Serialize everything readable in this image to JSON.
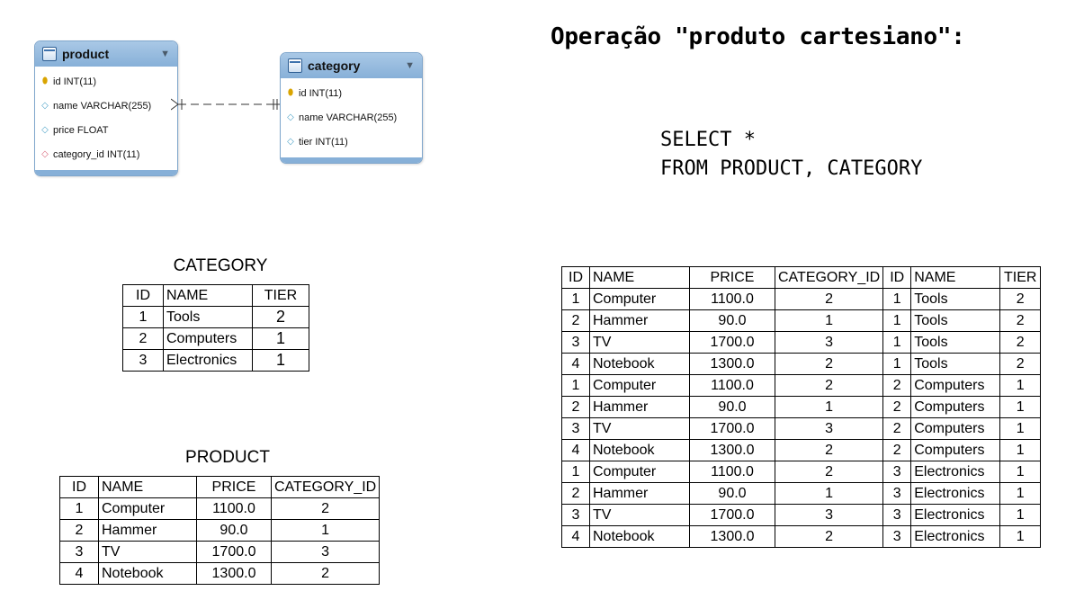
{
  "er_diagram": {
    "product": {
      "title": "product",
      "fields": [
        {
          "text": "id INT(11)",
          "icon": "key-icon"
        },
        {
          "text": "name VARCHAR(255)",
          "icon": "column-icon"
        },
        {
          "text": "price FLOAT",
          "icon": "column-icon"
        },
        {
          "text": "category_id INT(11)",
          "icon": "foreign-key-icon"
        }
      ]
    },
    "category": {
      "title": "category",
      "fields": [
        {
          "text": "id INT(11)",
          "icon": "key-icon"
        },
        {
          "text": "name VARCHAR(255)",
          "icon": "column-icon"
        },
        {
          "text": "tier INT(11)",
          "icon": "column-icon"
        }
      ]
    }
  },
  "heading": "Operação \"produto cartesiano\":",
  "sql": {
    "line1": "SELECT *",
    "line2": "FROM PRODUCT, CATEGORY"
  },
  "category_table": {
    "title": "CATEGORY",
    "headers": [
      "ID",
      "NAME",
      "TIER"
    ],
    "rows": [
      [
        "1",
        "Tools",
        "2"
      ],
      [
        "2",
        "Computers",
        "1"
      ],
      [
        "3",
        "Electronics",
        "1"
      ]
    ]
  },
  "product_table": {
    "title": "PRODUCT",
    "headers": [
      "ID",
      "NAME",
      "PRICE",
      "CATEGORY_ID"
    ],
    "rows": [
      [
        "1",
        "Computer",
        "1100.0",
        "2"
      ],
      [
        "2",
        "Hammer",
        "90.0",
        "1"
      ],
      [
        "3",
        "TV",
        "1700.0",
        "3"
      ],
      [
        "4",
        "Notebook",
        "1300.0",
        "2"
      ]
    ]
  },
  "result_table": {
    "headers": [
      "ID",
      "NAME",
      "PRICE",
      "CATEGORY_ID",
      "ID",
      "NAME",
      "TIER"
    ],
    "rows": [
      [
        "1",
        "Computer",
        "1100.0",
        "2",
        "1",
        "Tools",
        "2"
      ],
      [
        "2",
        "Hammer",
        "90.0",
        "1",
        "1",
        "Tools",
        "2"
      ],
      [
        "3",
        "TV",
        "1700.0",
        "3",
        "1",
        "Tools",
        "2"
      ],
      [
        "4",
        "Notebook",
        "1300.0",
        "2",
        "1",
        "Tools",
        "2"
      ],
      [
        "1",
        "Computer",
        "1100.0",
        "2",
        "2",
        "Computers",
        "1"
      ],
      [
        "2",
        "Hammer",
        "90.0",
        "1",
        "2",
        "Computers",
        "1"
      ],
      [
        "3",
        "TV",
        "1700.0",
        "3",
        "2",
        "Computers",
        "1"
      ],
      [
        "4",
        "Notebook",
        "1300.0",
        "2",
        "2",
        "Computers",
        "1"
      ],
      [
        "1",
        "Computer",
        "1100.0",
        "2",
        "3",
        "Electronics",
        "1"
      ],
      [
        "2",
        "Hammer",
        "90.0",
        "1",
        "3",
        "Electronics",
        "1"
      ],
      [
        "3",
        "TV",
        "1700.0",
        "3",
        "3",
        "Electronics",
        "1"
      ],
      [
        "4",
        "Notebook",
        "1300.0",
        "2",
        "3",
        "Electronics",
        "1"
      ]
    ]
  }
}
